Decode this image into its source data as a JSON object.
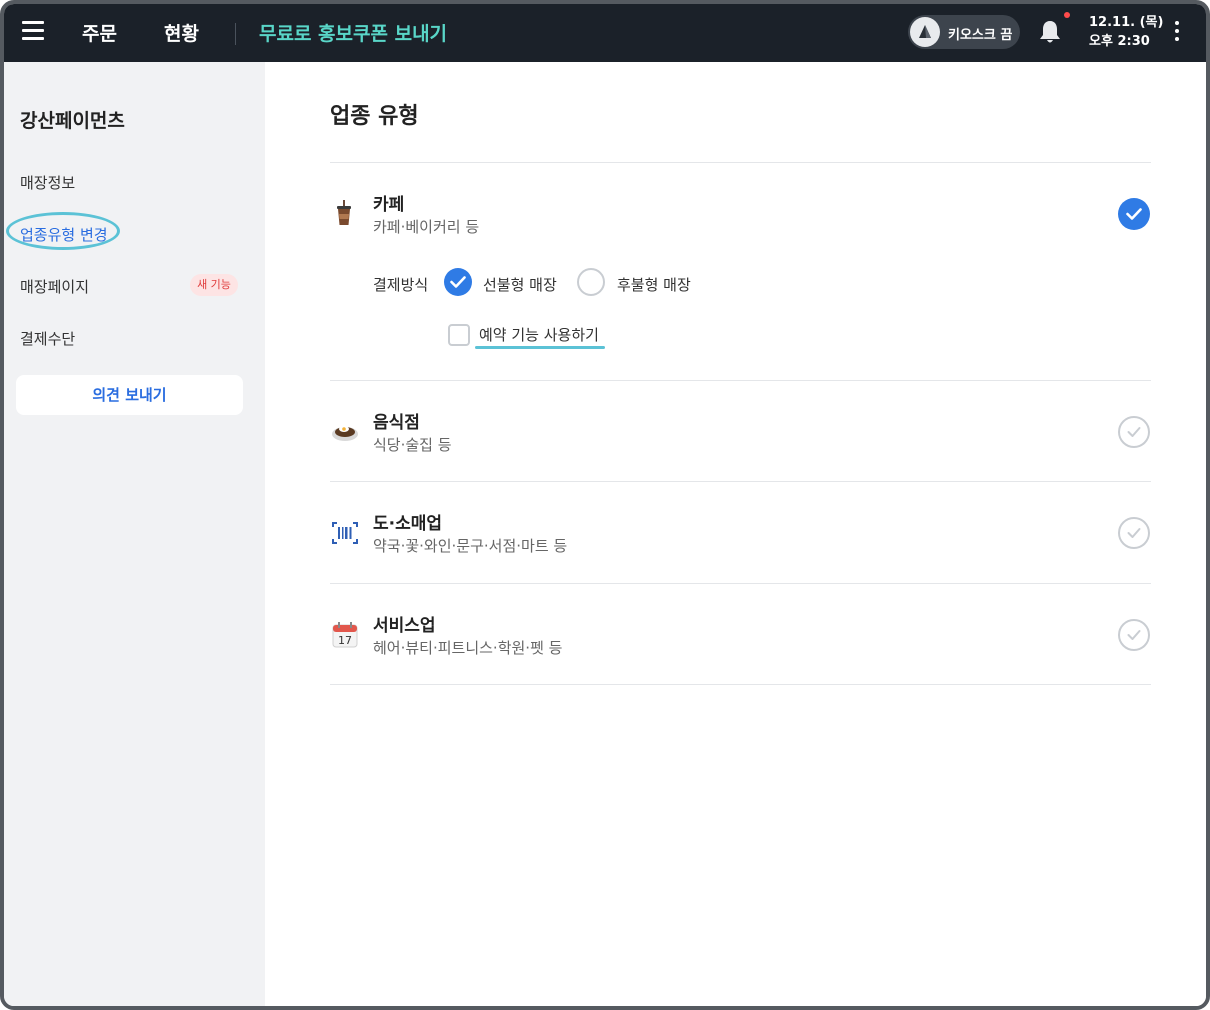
{
  "topbar": {
    "menu_icon": "hamburger-icon",
    "nav_order": "주문",
    "nav_status": "현황",
    "promo_link": "무료로 홍보쿠폰 보내기",
    "kiosk_toggle_label": "키오스크 끔",
    "kiosk_state": "off",
    "notification_icon": "bell-icon",
    "notification_dot": true,
    "date": "12.11. (목)",
    "time": "오후 2:30",
    "more_icon": "kebab-icon"
  },
  "sidebar": {
    "store_name": "강산페이먼츠",
    "items": [
      {
        "label": "매장정보",
        "active": false
      },
      {
        "label": "업종유형 변경",
        "active": true
      },
      {
        "label": "매장페이지",
        "active": false,
        "badge": "새 기능"
      },
      {
        "label": "결제수단",
        "active": false
      }
    ],
    "feedback_button": "의견 보내기"
  },
  "main": {
    "title": "업종 유형",
    "business_types": [
      {
        "icon": "iced-coffee-icon",
        "title": "카페",
        "desc": "카페·베이커리 등",
        "selected": true
      },
      {
        "icon": "food-plate-icon",
        "title": "음식점",
        "desc": "식당·술집 등",
        "selected": false
      },
      {
        "icon": "barcode-scanner-icon",
        "title": "도·소매업",
        "desc": "약국·꽃·와인·문구·서점·마트 등",
        "selected": false
      },
      {
        "icon": "calendar-icon",
        "title": "서비스업",
        "desc": "헤어·뷰티·피트니스·학원·펫 등",
        "selected": false
      }
    ],
    "calendar_icon_number": "17",
    "payment": {
      "label": "결제방식",
      "options": [
        {
          "label": "선불형 매장",
          "selected": true
        },
        {
          "label": "후불형 매장",
          "selected": false
        }
      ]
    },
    "reservation": {
      "label": "예약 기능 사용하기",
      "checked": false
    }
  },
  "colors": {
    "topbar_bg": "#1b2129",
    "accent_teal": "#59d6c8",
    "primary_blue": "#2f7be5",
    "badge_red": "#e03b3b"
  }
}
